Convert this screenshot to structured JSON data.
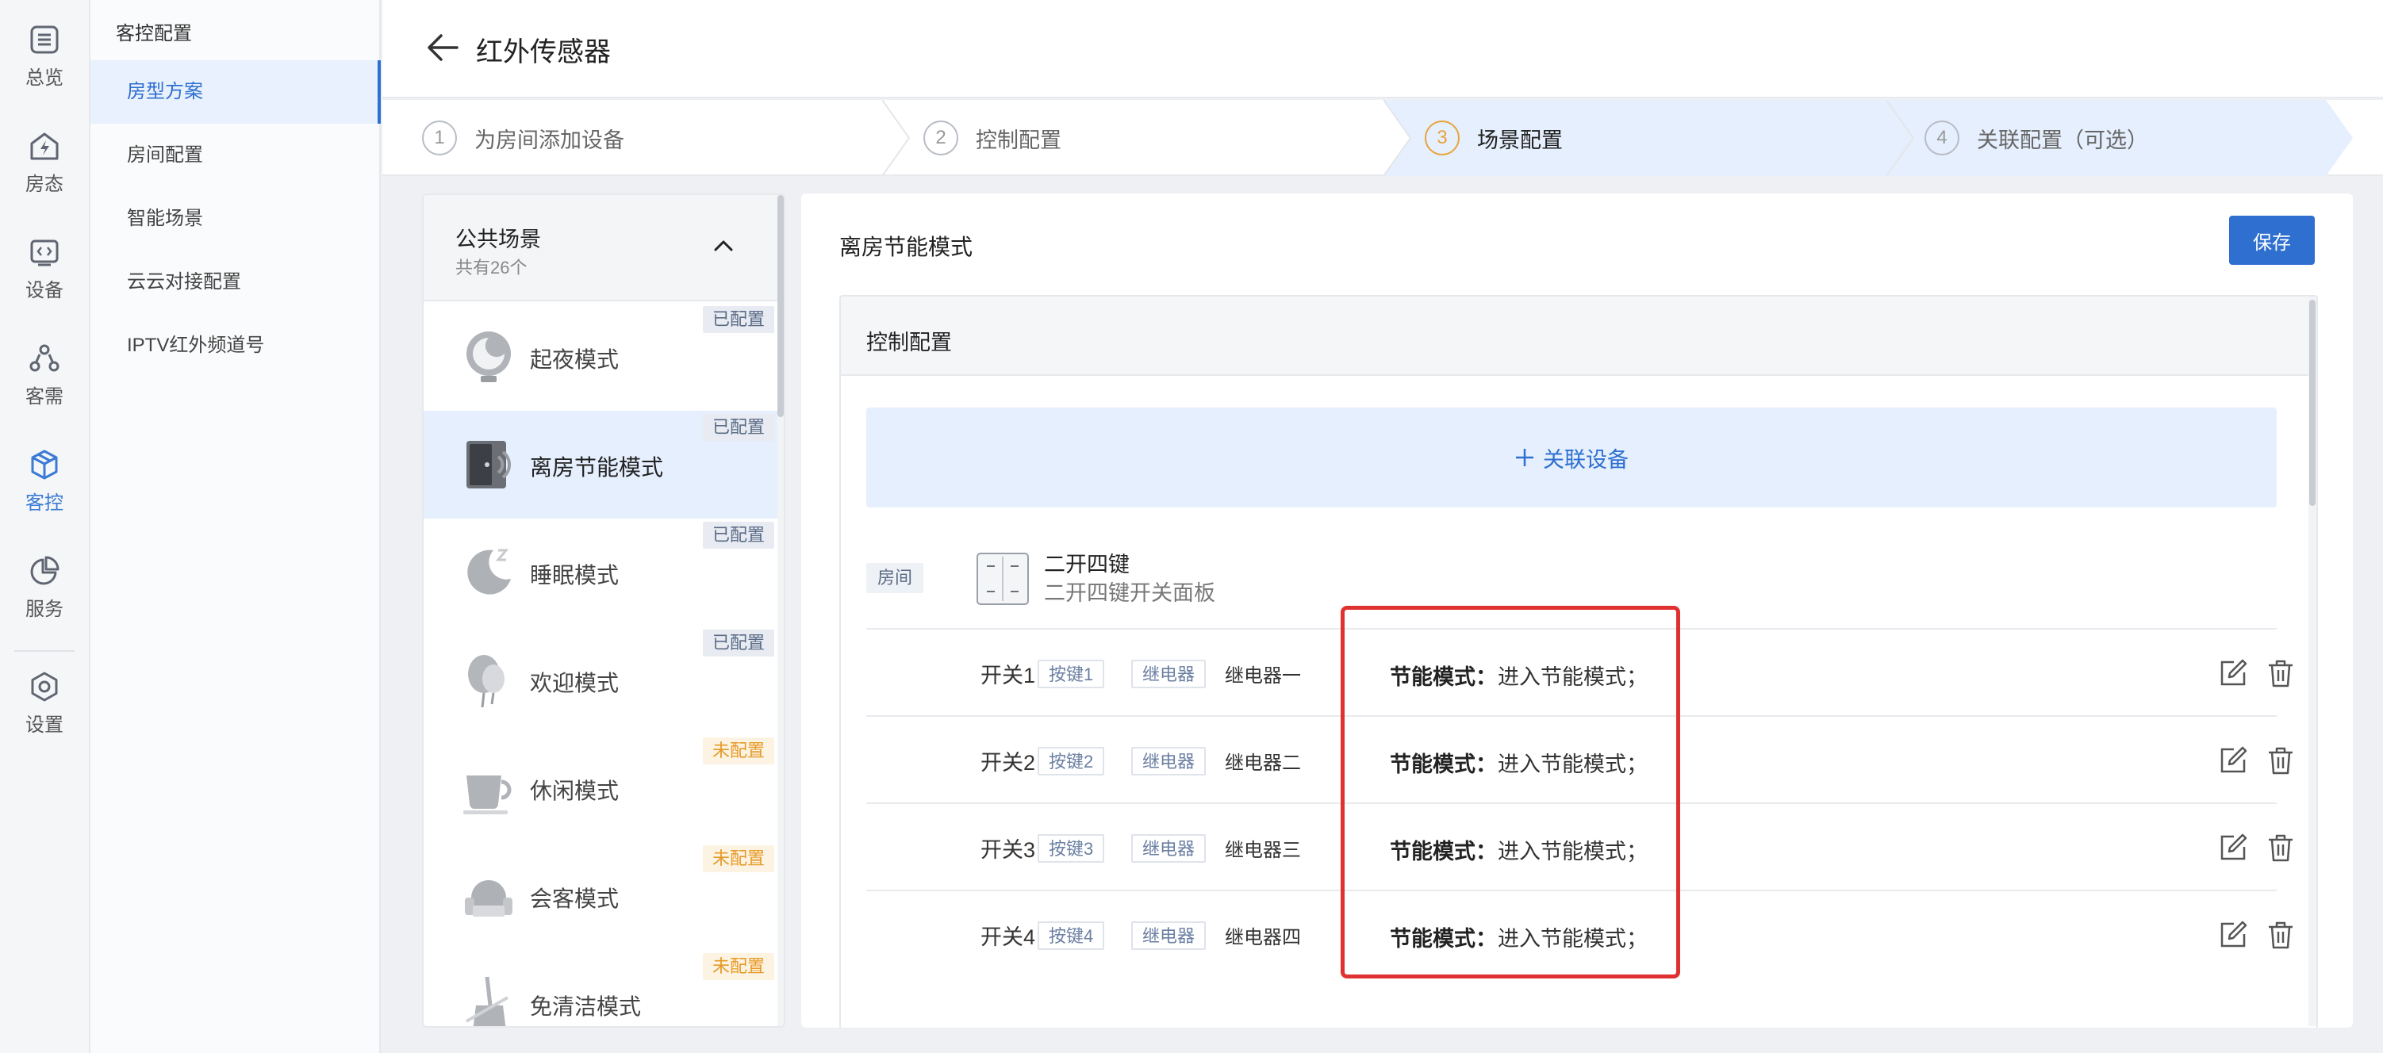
{
  "rail": [
    {
      "label": "总览",
      "icon": "overview-icon"
    },
    {
      "label": "房态",
      "icon": "room-status-icon"
    },
    {
      "label": "设备",
      "icon": "device-icon"
    },
    {
      "label": "客需",
      "icon": "guest-request-icon"
    },
    {
      "label": "客控",
      "icon": "guest-control-icon"
    },
    {
      "label": "服务",
      "icon": "service-icon"
    },
    {
      "label": "设置",
      "icon": "settings-icon"
    }
  ],
  "menu": {
    "title": "客控配置",
    "items": [
      {
        "label": "房型方案"
      },
      {
        "label": "房间配置"
      },
      {
        "label": "智能场景"
      },
      {
        "label": "云云对接配置"
      },
      {
        "label": "IPTV红外频道号"
      }
    ]
  },
  "header": {
    "title": "红外传感器"
  },
  "steps": [
    {
      "num": "1",
      "label": "为房间添加设备"
    },
    {
      "num": "2",
      "label": "控制配置"
    },
    {
      "num": "3",
      "label": "场景配置"
    },
    {
      "num": "4",
      "label": "关联配置（可选）"
    }
  ],
  "scene_list": {
    "title": "公共场景",
    "count": "共有26个",
    "items": [
      {
        "name": "起夜模式",
        "status": "已配置",
        "icon": "night-light-icon"
      },
      {
        "name": "离房节能模式",
        "status": "已配置",
        "icon": "leave-room-icon"
      },
      {
        "name": "睡眠模式",
        "status": "已配置",
        "icon": "sleep-moon-icon"
      },
      {
        "name": "欢迎模式",
        "status": "已配置",
        "icon": "welcome-balloon-icon"
      },
      {
        "name": "休闲模式",
        "status": "未配置",
        "icon": "coffee-cup-icon"
      },
      {
        "name": "会客模式",
        "status": "未配置",
        "icon": "sofa-icon"
      },
      {
        "name": "免清洁模式",
        "status": "未配置",
        "icon": "broom-icon"
      }
    ]
  },
  "main": {
    "scene_title": "离房节能模式",
    "save_label": "保存",
    "control_title": "控制配置",
    "add_device_label": "关联设备",
    "room_tag": "房间",
    "device_name": "二开四键",
    "device_sub": "二开四键开关面板",
    "rows": [
      {
        "switch": "开关1",
        "key": "按键1",
        "relay_tag": "继电器",
        "relay_name": "继电器一",
        "mode_label": "节能模式：",
        "mode_value": "进入节能模式；"
      },
      {
        "switch": "开关2",
        "key": "按键2",
        "relay_tag": "继电器",
        "relay_name": "继电器二",
        "mode_label": "节能模式：",
        "mode_value": "进入节能模式；"
      },
      {
        "switch": "开关3",
        "key": "按键3",
        "relay_tag": "继电器",
        "relay_name": "继电器三",
        "mode_label": "节能模式：",
        "mode_value": "进入节能模式；"
      },
      {
        "switch": "开关4",
        "key": "按键4",
        "relay_tag": "继电器",
        "relay_name": "继电器四",
        "mode_label": "节能模式：",
        "mode_value": "进入节能模式；"
      }
    ]
  },
  "colors": {
    "primary": "#2f6fd0",
    "active_bg": "#e5effd",
    "step_active": "#e8a33a",
    "badge_unconfigured": "#e69a28",
    "highlight": "#e03131"
  }
}
